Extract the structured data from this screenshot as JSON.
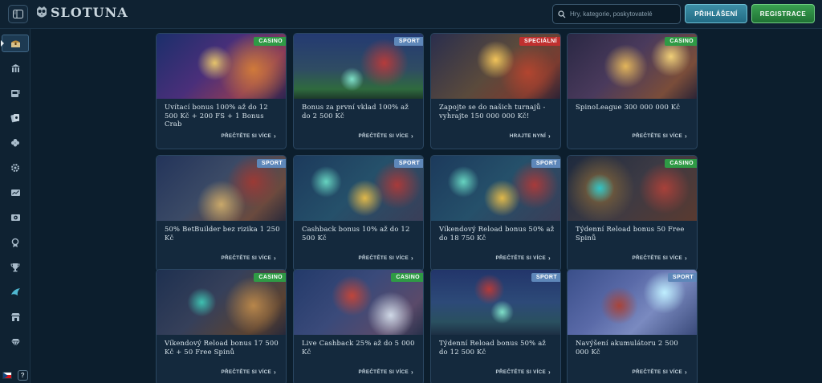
{
  "header": {
    "logo_text": "SLOTUNA",
    "search_placeholder": "Hry, kategorie, poskytovatelé",
    "login_label": "PŘIHLÁŠENÍ",
    "register_label": "REGISTRACE"
  },
  "sidebar": {
    "items": [
      {
        "icon": "treasure-chest-icon"
      },
      {
        "icon": "casino-building-icon"
      },
      {
        "icon": "slot-machine-icon"
      },
      {
        "icon": "live-cards-icon"
      },
      {
        "icon": "clover-icon"
      },
      {
        "icon": "gear-icon"
      },
      {
        "icon": "sports-screen-icon"
      },
      {
        "icon": "live-sport-icon"
      },
      {
        "icon": "medal-icon"
      },
      {
        "icon": "trophy-icon"
      },
      {
        "icon": "shark-icon"
      },
      {
        "icon": "shop-icon"
      },
      {
        "icon": "diamond-icon"
      }
    ],
    "help_label": "?"
  },
  "colors": {
    "background": "#0c1e2d",
    "casino_badge": "#2f9a45",
    "sport_badge": "#5e87b9",
    "special_badge": "#c0302f",
    "login_button": "#2a7c97",
    "register_button": "#2a8b42"
  },
  "promotions": [
    {
      "badge": "CASINO",
      "badge_type": "casino",
      "title": "Uvítací bonus 100% až do 12 500 Kč + 200 FS + 1 Bonus Crab",
      "link": "PŘEČTĚTE SI VÍCE"
    },
    {
      "badge": "SPORT",
      "badge_type": "sport",
      "title": "Bonus za první vklad 100% až do 2 500 Kč",
      "link": "PŘEČTĚTE SI VÍCE"
    },
    {
      "badge": "SPECIÁLNÍ",
      "badge_type": "special",
      "title": "Zapojte se do našich turnajů - vyhrajte 150 000 000 Kč!",
      "link": "HRAJTE NYNÍ"
    },
    {
      "badge": "CASINO",
      "badge_type": "casino",
      "title": "SpinoLeague 300 000 000 Kč",
      "link": "PŘEČTĚTE SI VÍCE"
    },
    {
      "badge": "SPORT",
      "badge_type": "sport",
      "title": "50% BetBuilder bez rizika 1 250 Kč",
      "link": "PŘEČTĚTE SI VÍCE"
    },
    {
      "badge": "SPORT",
      "badge_type": "sport",
      "title": "Cashback bonus 10% až do 12 500 Kč",
      "link": "PŘEČTĚTE SI VÍCE"
    },
    {
      "badge": "SPORT",
      "badge_type": "sport",
      "title": "Víkendový Reload bonus 50% až do 18 750 Kč",
      "link": "PŘEČTĚTE SI VÍCE"
    },
    {
      "badge": "CASINO",
      "badge_type": "casino",
      "title": "Týdenní Reload bonus 50 Free Spinů",
      "link": "PŘEČTĚTE SI VÍCE"
    },
    {
      "badge": "CASINO",
      "badge_type": "casino",
      "title": "Víkendový Reload bonus 17 500 Kč + 50 Free Spinů",
      "link": "PŘEČTĚTE SI VÍCE"
    },
    {
      "badge": "CASINO",
      "badge_type": "casino",
      "title": "Live Cashback 25% až do 5 000 Kč",
      "link": "PŘEČTĚTE SI VÍCE"
    },
    {
      "badge": "SPORT",
      "badge_type": "sport",
      "title": "Týdenní Reload bonus 50% až do 12 500 Kč",
      "link": "PŘEČTĚTE SI VÍCE"
    },
    {
      "badge": "SPORT",
      "badge_type": "sport",
      "title": "Navýšení akumulátoru 2 500 000 Kč",
      "link": "PŘEČTĚTE SI VÍCE"
    }
  ]
}
